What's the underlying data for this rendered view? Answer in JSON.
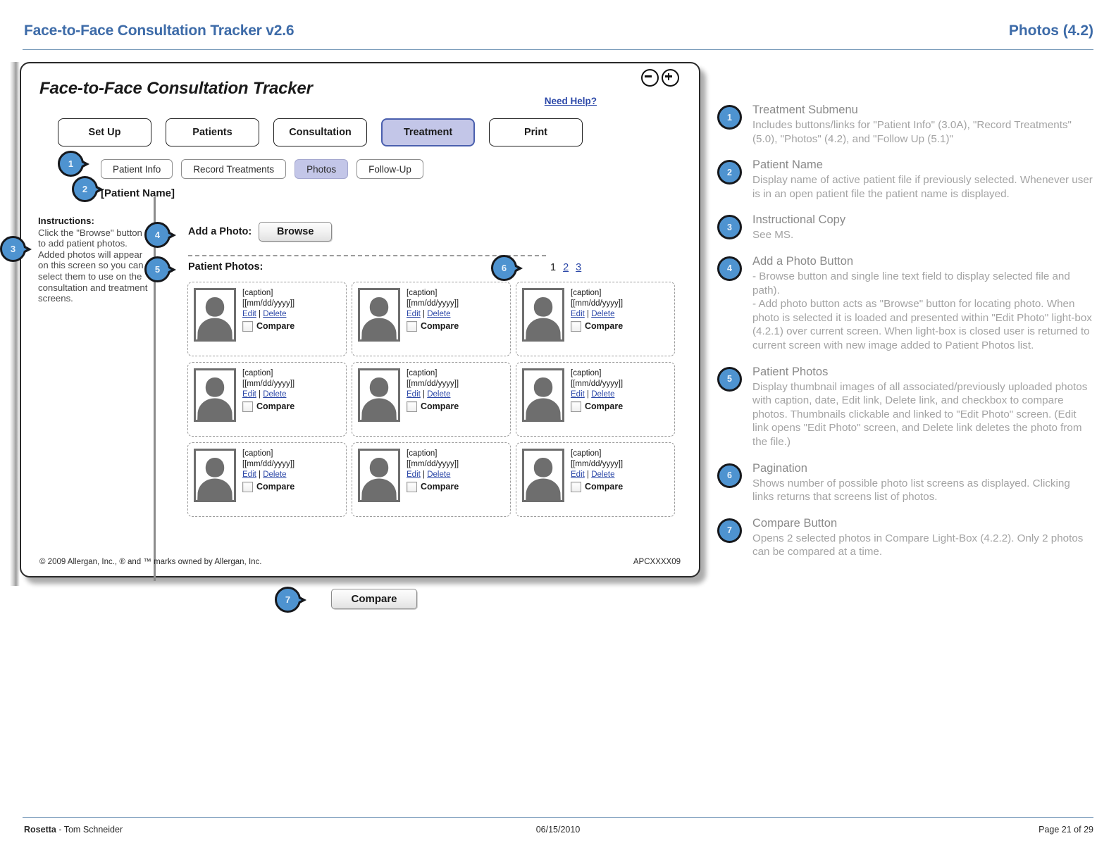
{
  "header": {
    "title": "Face-to-Face Consultation Tracker v2.6",
    "section": "Photos (4.2)"
  },
  "footer": {
    "author_bold": "Rosetta",
    "author_rest": " - Tom Schneider",
    "date": "06/15/2010",
    "page": "Page 21 of 29"
  },
  "wireframe": {
    "title": "Face-to-Face Consultation Tracker",
    "need_help": "Need Help?",
    "zoom_out_icon": "zoom-out-icon",
    "zoom_in_icon": "zoom-in-icon",
    "main_nav": [
      {
        "label": "Set Up",
        "active": false
      },
      {
        "label": "Patients",
        "active": false
      },
      {
        "label": "Consultation",
        "active": false
      },
      {
        "label": "Treatment",
        "active": true
      },
      {
        "label": "Print",
        "active": false
      }
    ],
    "sub_nav": [
      {
        "label": "Patient Info",
        "active": false
      },
      {
        "label": "Record Treatments",
        "active": false
      },
      {
        "label": "Photos",
        "active": true
      },
      {
        "label": "Follow-Up",
        "active": false
      }
    ],
    "patient_name": "[Patient Name]",
    "instructions_heading": "Instructions:",
    "instructions_body": "Click the \"Browse\" button to add patient photos. Added photos will appear on this screen so you can select them to use on the consultation and treatment screens.",
    "add_photo_label": "Add a Photo:",
    "browse_label": "Browse",
    "patient_photos_label": "Patient Photos:",
    "pagination": [
      {
        "label": "1",
        "current": true
      },
      {
        "label": "2",
        "current": false
      },
      {
        "label": "3",
        "current": false
      }
    ],
    "photo_cells": [
      {
        "caption": "[caption]",
        "date": "[[mm/dd/yyyy]]",
        "edit": "Edit",
        "sep": " | ",
        "delete": "Delete",
        "compare": "Compare"
      },
      {
        "caption": "[caption]",
        "date": "[[mm/dd/yyyy]]",
        "edit": "Edit",
        "sep": " | ",
        "delete": "Delete",
        "compare": "Compare"
      },
      {
        "caption": "[caption]",
        "date": "[[mm/dd/yyyy]]",
        "edit": "Edit",
        "sep": " | ",
        "delete": "Delete",
        "compare": "Compare"
      },
      {
        "caption": "[caption]",
        "date": "[[mm/dd/yyyy]]",
        "edit": "Edit",
        "sep": " | ",
        "delete": "Delete",
        "compare": "Compare"
      },
      {
        "caption": "[caption]",
        "date": "[[mm/dd/yyyy]]",
        "edit": "Edit",
        "sep": " | ",
        "delete": "Delete",
        "compare": "Compare"
      },
      {
        "caption": "[caption]",
        "date": "[[mm/dd/yyyy]]",
        "edit": "Edit",
        "sep": " | ",
        "delete": "Delete",
        "compare": "Compare"
      },
      {
        "caption": "[caption]",
        "date": "[[mm/dd/yyyy]]",
        "edit": "Edit",
        "sep": " | ",
        "delete": "Delete",
        "compare": "Compare"
      },
      {
        "caption": "[caption]",
        "date": "[[mm/dd/yyyy]]",
        "edit": "Edit",
        "sep": " | ",
        "delete": "Delete",
        "compare": "Compare"
      },
      {
        "caption": "[caption]",
        "date": "[[mm/dd/yyyy]]",
        "edit": "Edit",
        "sep": " | ",
        "delete": "Delete",
        "compare": "Compare"
      }
    ],
    "compare_button": "Compare",
    "copyright": "© 2009 Allergan, Inc.,  ® and ™ marks owned by Allergan, Inc.",
    "doc_code": "APCXXXX09"
  },
  "callouts": [
    {
      "number": "1"
    },
    {
      "number": "2"
    },
    {
      "number": "3"
    },
    {
      "number": "4"
    },
    {
      "number": "5"
    },
    {
      "number": "6"
    },
    {
      "number": "7"
    }
  ],
  "annotations": [
    {
      "number": "1",
      "title": "Treatment Submenu",
      "body": "Includes buttons/links for \"Patient Info\" (3.0A),  \"Record Treatments\" (5.0), \"Photos\" (4.2), and \"Follow Up (5.1)\""
    },
    {
      "number": "2",
      "title": "Patient Name",
      "body": "Display name of active patient file if previously selected. Whenever user is in an open patient file the patient name is displayed."
    },
    {
      "number": "3",
      "title": "Instructional Copy",
      "body": "See MS."
    },
    {
      "number": "4",
      "title": "Add a Photo Button",
      "body": "- Browse button and single line text field to display selected file and path).\n- Add photo button acts as \"Browse\" button for locating photo. When photo is selected it is loaded and presented within \"Edit Photo\" light-box (4.2.1) over current screen. When light-box is closed user is returned to current screen with new image added to Patient Photos list."
    },
    {
      "number": "5",
      "title": "Patient Photos",
      "body": "Display thumbnail images of all associated/previously uploaded photos with caption, date, Edit link, Delete link, and checkbox to compare photos. Thumbnails clickable and linked to \"Edit Photo\" screen. (Edit link opens \"Edit Photo\" screen, and Delete link deletes the photo from the file.)"
    },
    {
      "number": "6",
      "title": "Pagination",
      "body": "Shows number of possible photo list screens as displayed. Clicking links returns that screens list of photos."
    },
    {
      "number": "7",
      "title": "Compare Button",
      "body": "Opens 2 selected photos in Compare Light-Box (4.2.2). Only 2 photos can be compared at a time."
    }
  ],
  "colors": {
    "header_blue": "#3d6ba8",
    "link_blue": "#2c48a8",
    "callout_blue": "#4e93d0",
    "active_tab": "#c3c6e8",
    "annotation_gray": "#a3a3a3"
  }
}
